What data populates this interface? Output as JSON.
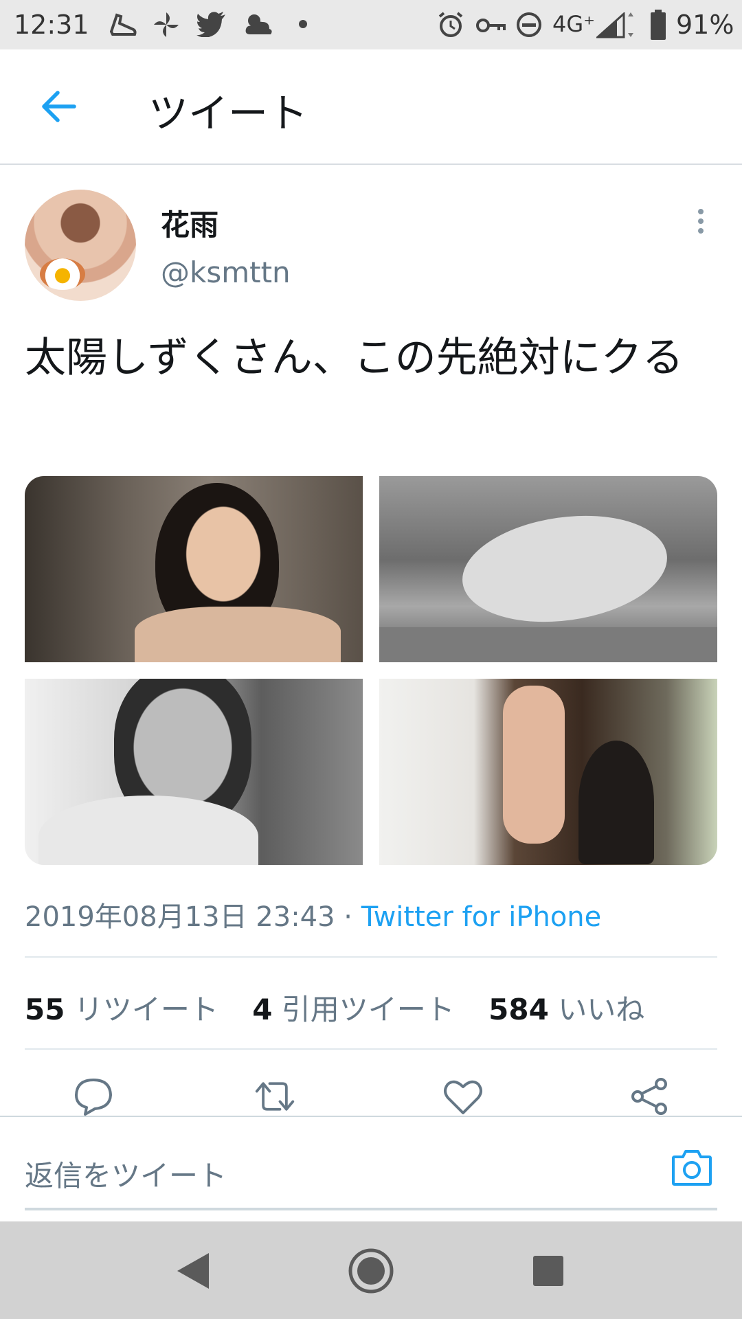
{
  "status_bar": {
    "time": "12:31",
    "network": "4G⁺",
    "battery": "91%"
  },
  "header": {
    "title": "ツイート"
  },
  "tweet": {
    "author": {
      "name": "花雨",
      "handle": "@ksmttn"
    },
    "text": "太陽しずくさん、この先絶対にクる",
    "timestamp": "2019年08月13日 23:43",
    "separator": " · ",
    "source": "Twitter for iPhone",
    "stats": [
      {
        "count": "55",
        "label": "リツイート"
      },
      {
        "count": "4",
        "label": "引用ツイート"
      },
      {
        "count": "584",
        "label": "いいね"
      }
    ]
  },
  "reply": {
    "placeholder": "返信をツイート"
  },
  "colors": {
    "accent": "#1da1f2",
    "secondary_text": "#657786",
    "primary_text": "#14171a"
  },
  "icons": {
    "back": "arrow-left-icon",
    "more": "more-vertical-icon",
    "reply": "reply-bubble-icon",
    "retweet": "retweet-icon",
    "like": "heart-icon",
    "share": "share-icon",
    "camera": "camera-icon"
  }
}
